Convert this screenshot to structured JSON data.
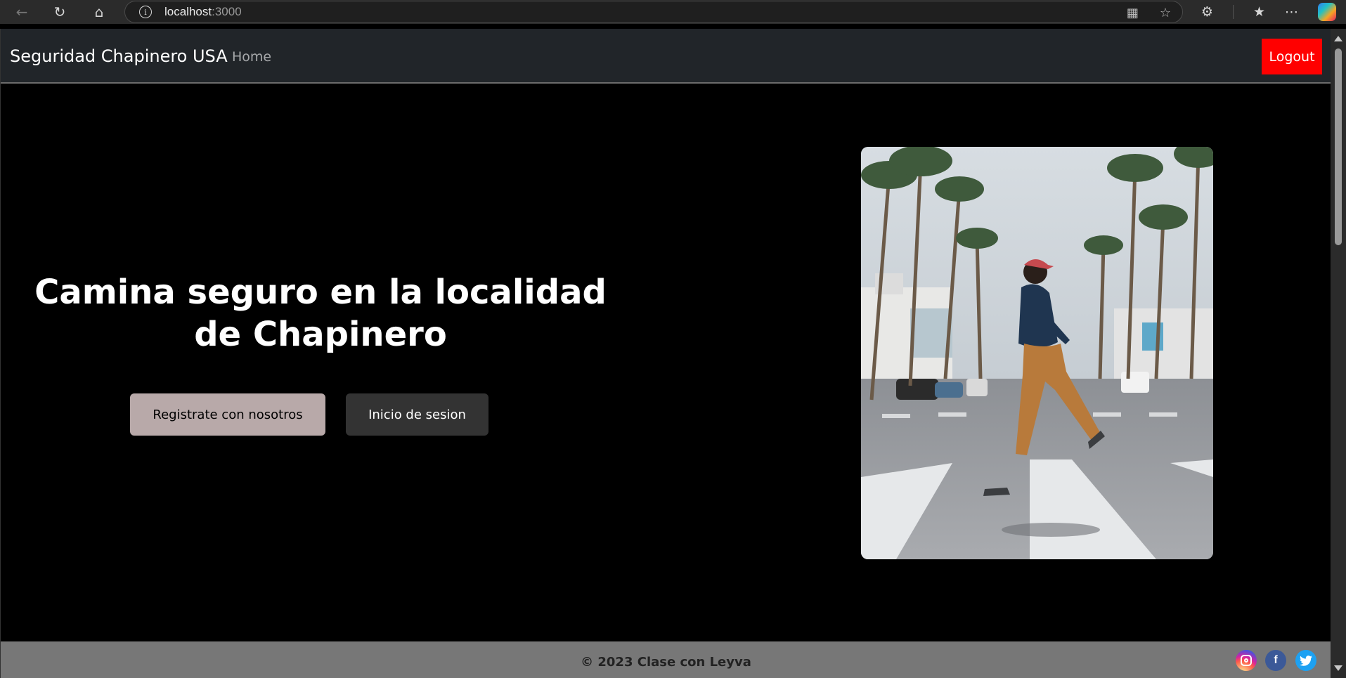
{
  "browser": {
    "url_host": "localhost",
    "url_port": ":3000"
  },
  "navbar": {
    "brand": "Seguridad Chapinero USA",
    "home_label": "Home",
    "logout_label": "Logout"
  },
  "hero": {
    "title": "Camina seguro en la localidad de Chapinero",
    "register_label": "Registrate con nosotros",
    "login_label": "Inicio de sesion"
  },
  "footer": {
    "text": "© 2023 Clase con Leyva",
    "social_icons": [
      "instagram-icon",
      "facebook-icon",
      "twitter-icon"
    ]
  },
  "colors": {
    "logout_bg": "#ff0000",
    "register_bg": "#b8a9a9",
    "login_bg": "#333333",
    "navbar_bg": "#212529",
    "footer_bg": "#777777"
  }
}
